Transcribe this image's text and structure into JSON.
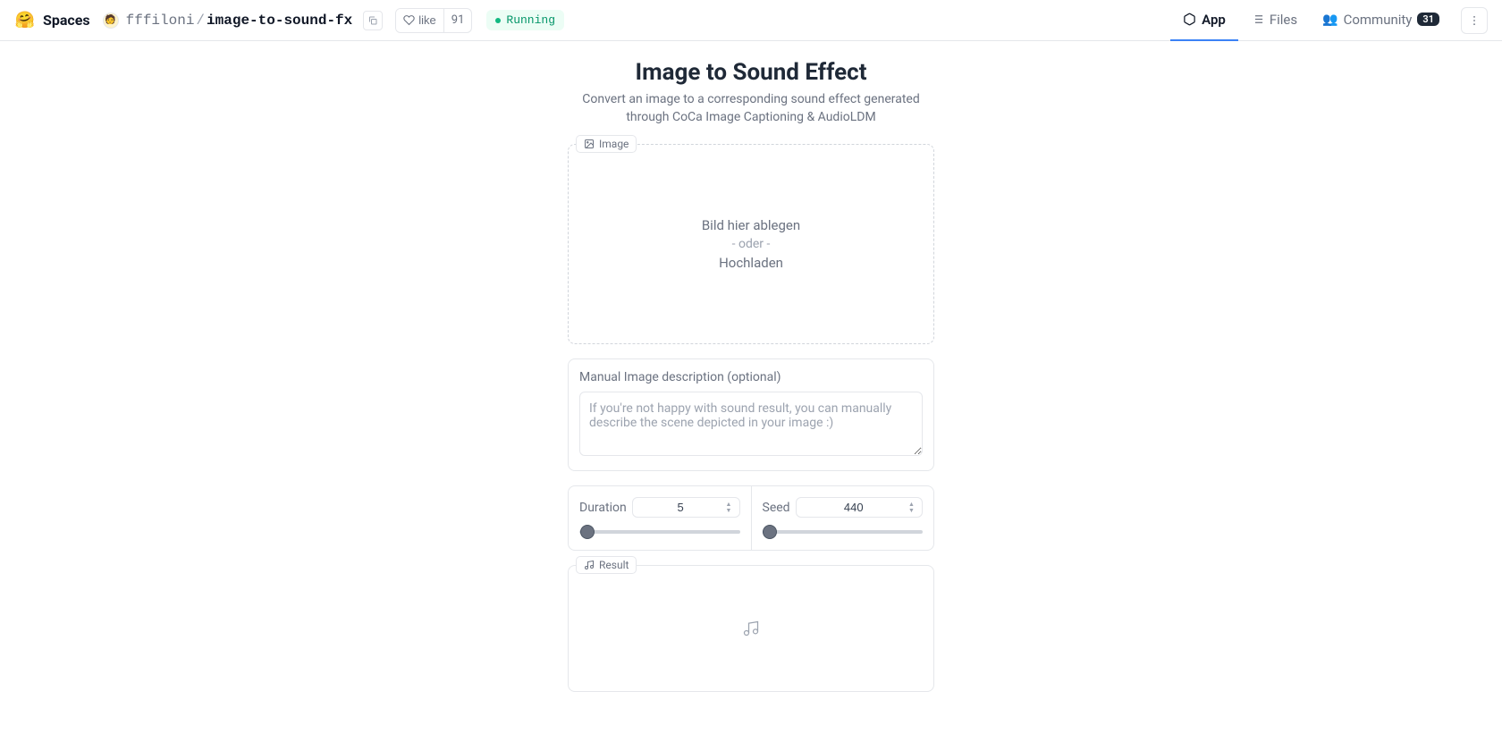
{
  "header": {
    "spaces": "Spaces",
    "owner": "fffiloni",
    "slash": "/",
    "repo": "image-to-sound-fx",
    "like_label": "like",
    "like_count": "91",
    "status": "Running"
  },
  "nav": {
    "app": "App",
    "files": "Files",
    "community": "Community",
    "community_count": "31"
  },
  "main": {
    "title": "Image to Sound Effect",
    "subtitle": "Convert an image to a corresponding sound effect generated through CoCa Image Captioning & AudioLDM"
  },
  "image_panel": {
    "label": "Image",
    "drop_here": "Bild hier ablegen",
    "or": "- oder -",
    "upload": "Hochladen"
  },
  "desc_panel": {
    "label": "Manual Image description (optional)",
    "placeholder": "If you're not happy with sound result, you can manually describe the scene depicted in your image :)"
  },
  "controls": {
    "duration_label": "Duration",
    "duration_value": "5",
    "seed_label": "Seed",
    "seed_value": "440"
  },
  "result_panel": {
    "label": "Result"
  }
}
